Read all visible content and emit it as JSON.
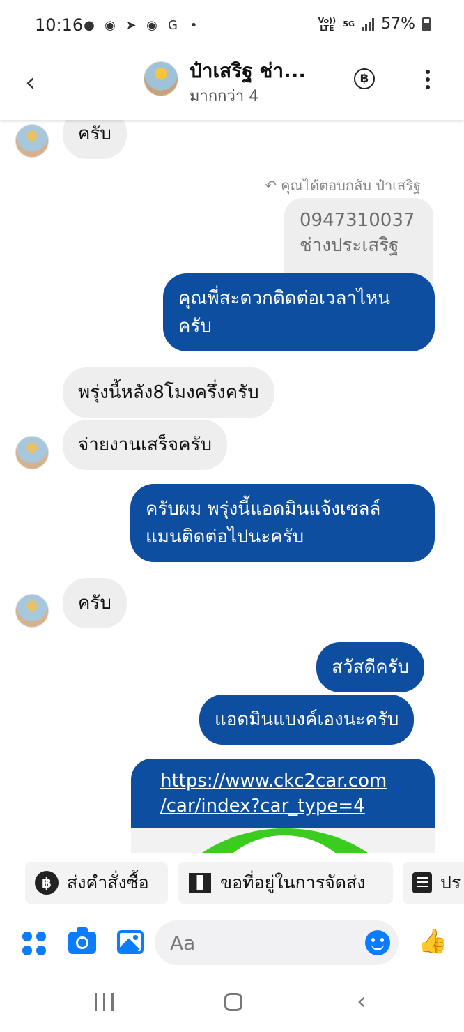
{
  "status_bar": {
    "time": "10:16",
    "app_icons": [
      "chat-bubble-icon",
      "messenger-icon",
      "nav-arrow-icon",
      "line-icon",
      "g-icon",
      "dot-icon"
    ],
    "network_top": "Vo)) LTE",
    "network_5g": "5G",
    "battery": "57%"
  },
  "header": {
    "contact_name": "ป๋าเสริฐ ช่า...",
    "subtitle": "มากกว่า 4",
    "baht_symbol": "฿"
  },
  "messages": [
    {
      "side": "in",
      "text": "ครับ"
    },
    {
      "side": "reply_note",
      "text": "คุณได้ตอบกลับ ป๋าเสริฐ"
    },
    {
      "side": "quoted",
      "line1": "0947310037",
      "line2": "ช่างประเสริฐ"
    },
    {
      "side": "out",
      "line1": "คุณพี่สะดวกติดต่อเวลาไหน",
      "line2": "ครับ"
    },
    {
      "side": "in",
      "text": "พรุ่งนี้หลัง8โมงครึ่งครับ"
    },
    {
      "side": "in",
      "text": "จ่ายงานเสร็จครับ"
    },
    {
      "side": "out",
      "line1": "ครับผม พรุ่งนี้แอดมินแจ้งเซลล์",
      "line2": "แมนติดต่อไปนะครับ"
    },
    {
      "side": "in",
      "text": "ครับ"
    },
    {
      "side": "out",
      "text": "สวัสดีครับ"
    },
    {
      "side": "out",
      "text": "แอดมินแบงค์เองนะครับ"
    },
    {
      "side": "out_link",
      "line1": "https://www.ckc2car.com",
      "line2": "/car/index?car_type=4"
    }
  ],
  "quick_replies": [
    {
      "label": "ส่งคำสั่งซื้อ",
      "icon": "baht-icon"
    },
    {
      "label": "ขอที่อยู่ในการจัดส่ง",
      "icon": "map-icon"
    },
    {
      "label": "ปร",
      "icon": "list-icon"
    }
  ],
  "composer": {
    "placeholder": "Aa"
  },
  "colors": {
    "outgoing_bubble": "#0e4ea0",
    "incoming_bubble": "#eeeeee",
    "accent": "#0a7cff"
  }
}
